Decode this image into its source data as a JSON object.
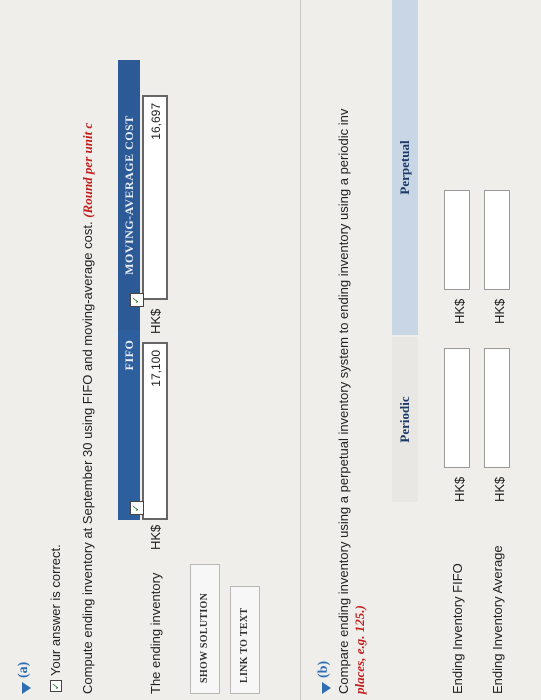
{
  "part_a": {
    "label": "(a)",
    "correct_message": "Your answer is correct.",
    "instruction": "Compute ending inventory at September 30 using FIFO and moving-average cost.",
    "note": "(Round per unit c",
    "fifo_header": "FIFO",
    "moving_header": "MOVING-AVERAGE COST",
    "row_label": "The ending inventory",
    "currency": "HK$",
    "fifo_value": "17,100",
    "moving_value": "16,697",
    "show_solution": "SHOW SOLUTION",
    "link_to_text": "LINK TO TEXT"
  },
  "part_b": {
    "label": "(b)",
    "instruction": "Compare ending inventory using a perpetual inventory system to ending inventory using a periodic inv",
    "note": "places, e.g. 125.)",
    "periodic_header": "Periodic",
    "perpetual_header": "Perpetual",
    "currency": "HK$",
    "rows": [
      {
        "label": "Ending Inventory FIFO"
      },
      {
        "label": "Ending Inventory Average"
      }
    ]
  }
}
